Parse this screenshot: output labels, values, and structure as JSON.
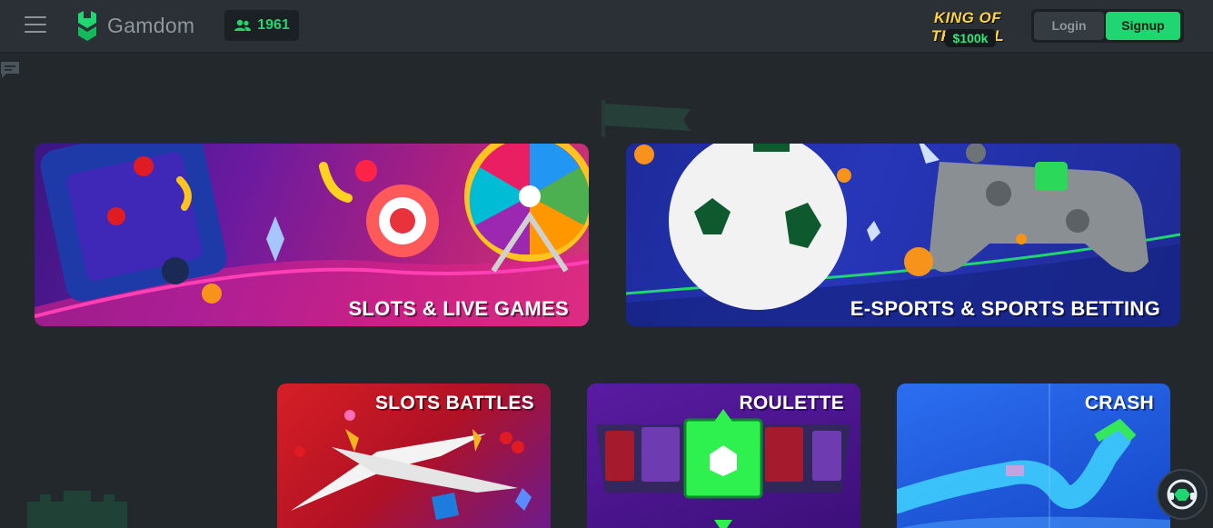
{
  "header": {
    "brand": "Gamdom",
    "online_count": "1961",
    "promo": {
      "title": "KING OF THE HILL",
      "prize": "$100k"
    },
    "login_label": "Login",
    "signup_label": "Signup"
  },
  "cards": {
    "slots_live": "SLOTS & LIVE GAMES",
    "esports": "E-SPORTS & SPORTS BETTING",
    "slots_battles": "SLOTS BATTLES",
    "roulette": "ROULETTE",
    "crash": "CRASH"
  },
  "colors": {
    "accent": "#1fd670",
    "header_bg": "#2a3035",
    "page_bg": "#23282d"
  },
  "icons": [
    "menu-icon",
    "gamdom-logo-icon",
    "users-icon",
    "chat-icon",
    "support-icon"
  ]
}
